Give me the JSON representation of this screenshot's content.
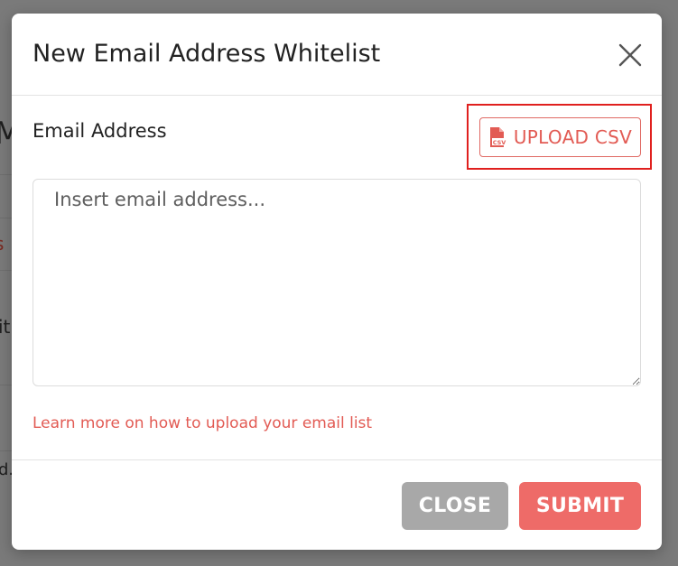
{
  "background": {
    "fragments": [
      "M",
      "s",
      "it",
      "d."
    ]
  },
  "modal": {
    "title": "New Email Address Whitelist",
    "close_icon": "close-icon"
  },
  "form": {
    "field_label": "Email Address",
    "upload_button_label": "UPLOAD CSV",
    "upload_icon": "csv-file-icon",
    "textarea_placeholder": "Insert email address...",
    "textarea_value": "",
    "help_link": "Learn more on how to upload your email list"
  },
  "footer": {
    "close_label": "CLOSE",
    "submit_label": "SUBMIT"
  },
  "colors": {
    "accent": "#e25b54",
    "submit_bg": "#ee6b68",
    "close_bg": "#a8a8a8",
    "highlight": "#e0201e",
    "overlay": "#7f7f7f"
  }
}
